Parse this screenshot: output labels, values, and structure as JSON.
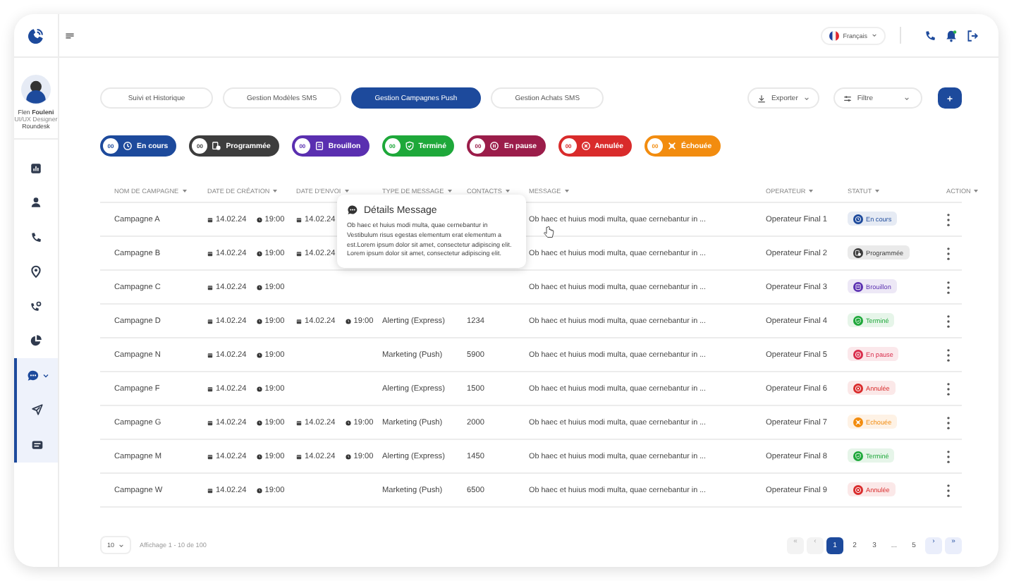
{
  "sidebar": {
    "user": {
      "name": "Flen **Fouleni**",
      "role": "UI/UX Designer",
      "company": "Roundesk"
    },
    "items": [
      {
        "kind": "chart",
        "selected": false
      },
      {
        "kind": "user",
        "selected": false
      },
      {
        "kind": "phone",
        "selected": false
      },
      {
        "kind": "pin",
        "selected": false
      },
      {
        "kind": "phonegear",
        "selected": false
      },
      {
        "kind": "pie",
        "selected": false
      },
      {
        "kind": "chat",
        "selected": true,
        "expanded": true,
        "children": [
          {
            "kind": "send",
            "selected": false
          },
          {
            "kind": "sms",
            "selected": false
          }
        ]
      }
    ]
  },
  "header": {
    "language": "Français"
  },
  "tabs": [
    {
      "label": "Suivi et Historique",
      "selected": false
    },
    {
      "label": "Gestion Modèles SMS",
      "selected": false
    },
    {
      "label": "Gestion Campagnes Push",
      "selected": true
    },
    {
      "label": "Gestion Achats SMS",
      "selected": false
    }
  ],
  "toolbar": {
    "export": "Exporter",
    "filter": "Filtre"
  },
  "chips": [
    {
      "count": "00",
      "kind": "en_cours",
      "label": "En cours",
      "color": "#1d4a9c"
    },
    {
      "count": "00",
      "kind": "programmee",
      "label": "Programmée",
      "color": "#3d3d3d"
    },
    {
      "count": "00",
      "kind": "brouillon",
      "label": "Brouillon",
      "color": "#5a2fb0"
    },
    {
      "count": "00",
      "kind": "termine",
      "label": "Terminé",
      "color": "#1ea83a"
    },
    {
      "count": "00",
      "kind": "pause",
      "label": "En pause",
      "color": "#9b1d4a"
    },
    {
      "count": "00",
      "kind": "annulee",
      "label": "Annulée",
      "color": "#d92b2b"
    },
    {
      "count": "00",
      "kind": "echouee",
      "label": "Échouée",
      "color": "#f28c0f"
    }
  ],
  "table": {
    "columns": [
      "NOM DE CAMPAGNE",
      "DATE DE CRÉATION",
      "DATE D'ENVOI",
      "TYPE DE MESSAGE",
      "CONTACTS",
      "MESSAGE",
      "OPERATEUR",
      "STATUT",
      "ACTION"
    ],
    "rows": [
      {
        "name": "Campagne A",
        "created": {
          "date": "14.02.24",
          "time": "19:00"
        },
        "sent": {
          "date": "14.02.24"
        },
        "message": "Ob haec et huius modi multa, quae cernebantur in ...",
        "operator": "Operateur Final 1",
        "status": {
          "kind": "en_cours",
          "label": "En cours",
          "color": "#1d4a9c"
        }
      },
      {
        "name": "Campagne B",
        "created": {
          "date": "14.02.24",
          "time": "19:00"
        },
        "sent": {
          "date": "14.02.24"
        },
        "message": "Ob haec et huius modi multa, quae cernebantur in ...",
        "operator": "Operateur Final 2",
        "status": {
          "kind": "programmee",
          "label": "Programmée",
          "color": "#3d3d3d"
        }
      },
      {
        "name": "Campagne C",
        "created": {
          "date": "14.02.24",
          "time": "19:00"
        },
        "message": "Ob haec et huius modi multa, quae cernebantur in ...",
        "operator": "Operateur Final 3",
        "status": {
          "kind": "brouillon",
          "label": "Brouillon",
          "color": "#5a2fb0"
        }
      },
      {
        "name": "Campagne D",
        "created": {
          "date": "14.02.24",
          "time": "19:00"
        },
        "sent": {
          "date": "14.02.24",
          "time": "19:00"
        },
        "type": "Alerting (Express)",
        "contacts": "1234",
        "message": "Ob haec et huius modi multa, quae cernebantur in ...",
        "operator": "Operateur Final 4",
        "status": {
          "kind": "termine",
          "label": "Terminé",
          "color": "#1ea83a"
        }
      },
      {
        "name": "Campagne N",
        "created": {
          "date": "14.02.24",
          "time": "19:00"
        },
        "type": "Marketing (Push)",
        "contacts": "5900",
        "message": "Ob haec et huius modi multa, quae cernebantur in ...",
        "operator": "Operateur Final 5",
        "status": {
          "kind": "pause",
          "label": "En pause",
          "color": "#d92b4a"
        }
      },
      {
        "name": "Campagne F",
        "created": {
          "date": "14.02.24",
          "time": "19:00"
        },
        "type": "Alerting (Express)",
        "contacts": "1500",
        "message": "Ob haec et huius modi multa, quae cernebantur in ...",
        "operator": "Operateur Final 6",
        "status": {
          "kind": "annulee",
          "label": "Annulée",
          "color": "#d92b2b"
        }
      },
      {
        "name": "Campagne G",
        "created": {
          "date": "14.02.24",
          "time": "19:00"
        },
        "sent": {
          "date": "14.02.24",
          "time": "19:00"
        },
        "type": "Marketing (Push)",
        "contacts": "2000",
        "message": "Ob haec et huius modi multa, quae cernebantur in ...",
        "operator": "Operateur Final 7",
        "status": {
          "kind": "echouee",
          "label": "Echouée",
          "color": "#f28c0f"
        }
      },
      {
        "name": "Campagne M",
        "created": {
          "date": "14.02.24",
          "time": "19:00"
        },
        "sent": {
          "date": "14.02.24",
          "time": "19:00"
        },
        "type": "Alerting (Express)",
        "contacts": "1450",
        "message": "Ob haec et huius modi multa, quae cernebantur in ...",
        "operator": "Operateur Final 8",
        "status": {
          "kind": "termine",
          "label": "Terminé",
          "color": "#1ea83a"
        }
      },
      {
        "name": "Campagne W",
        "created": {
          "date": "14.02.24",
          "time": "19:00"
        },
        "type": "Marketing (Push)",
        "contacts": "6500",
        "message": "Ob haec et huius modi multa, quae cernebantur in ...",
        "operator": "Operateur Final 9",
        "status": {
          "kind": "annulee",
          "label": "Annulée",
          "color": "#d92b2b"
        }
      }
    ]
  },
  "tooltip": {
    "title": "Détails Message",
    "text": "Ob haec et huius modi multa, quae cernebantur in Vestibulum risus egestas elementum erat elementum a est.Lorem ipsum dolor sit amet, consectetur adipiscing elit. Lorem ipsum dolor sit amet, consectetur adipiscing elit."
  },
  "footer": {
    "per_page": "10",
    "summary": "Affichage 1 - 10 de 100",
    "nav_first": [
      {
        "label": "«",
        "disabled": true
      },
      {
        "label": "‹",
        "disabled": true
      }
    ],
    "pages": [
      {
        "label": "1",
        "selected": true
      },
      {
        "label": "2",
        "selected": false
      },
      {
        "label": "3",
        "selected": false
      },
      {
        "label": "...",
        "selected": false
      },
      {
        "label": "5",
        "selected": false
      }
    ],
    "nav_last": [
      {
        "label": "›",
        "disabled": false
      },
      {
        "label": "»",
        "disabled": false
      }
    ]
  }
}
